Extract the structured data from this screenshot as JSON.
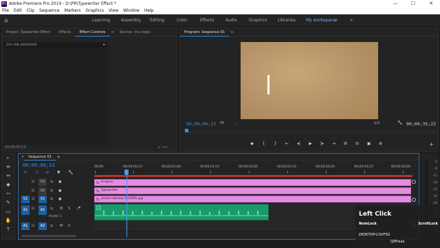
{
  "window": {
    "app_icon_text": "Pr",
    "title": "Adobe Premiere Pro 2019 - D:\\PR\\Typewriter Effect *",
    "controls": [
      "—",
      "☐",
      "✕"
    ]
  },
  "menu": [
    "File",
    "Edit",
    "Clip",
    "Sequence",
    "Markers",
    "Graphics",
    "View",
    "Window",
    "Help"
  ],
  "workspaces": {
    "items": [
      "Learning",
      "Assembly",
      "Editing",
      "Color",
      "Effects",
      "Audio",
      "Graphics",
      "Libraries"
    ],
    "active": "My workspace",
    "active_menu_icon": "≡",
    "more": "»"
  },
  "left_panel": {
    "tabs": [
      "Project: Typewriter Effect",
      "Effects",
      "Effect Controls",
      "Source: (no clips)"
    ],
    "active_tab_menu": "≡",
    "clip_select": "(no clip selected)",
    "clip_select_arrow": "▸",
    "timecode": "00;00;00;13",
    "footer_icons": "⊿ ⇥ ⇤"
  },
  "program_panel": {
    "title": "Program: Sequence 01",
    "title_menu": "≡",
    "timecode": "00;00;00;13",
    "fit": "Fit",
    "resolution": "1/2",
    "duration": "00;00;35;22",
    "controls": [
      "◆",
      "{",
      "}",
      "⇤",
      "◂|",
      "▶",
      "|▸",
      "⇥",
      "⊞",
      "⊟",
      "▣",
      "⊕"
    ]
  },
  "tools": [
    "▸",
    "⇹",
    "⇔",
    "◆",
    "⇿",
    "✎",
    "▭",
    "✋",
    "T"
  ],
  "timeline": {
    "tab_title": "Sequence 01",
    "tab_menu": "≡",
    "timecode": "00;00;00;13",
    "ruler_labels": [
      "00;00",
      "00;00;00;15",
      "00;00;01;00",
      "00;00;01;15",
      "00;00;02;00",
      "00;00;02;15",
      "00;00;03;00",
      "00;00;03;15",
      "00;00;04;00"
    ],
    "tracks": {
      "v3": "V3",
      "v2": "V2",
      "v1": "V1",
      "a1": "A1",
      "a2": "A2",
      "audio1_name": "Audio 1",
      "lock": "⊡",
      "eye": "●",
      "m": "M",
      "s": "S",
      "mic": "🎤"
    },
    "clips": {
      "v3": "Graphic",
      "v2": "Typewriter",
      "v1": "pexels-abaxey-233985.jpg"
    },
    "tool_icons": [
      "⊓",
      "⊃",
      "⊳",
      "▼",
      "🔧"
    ],
    "clip_fx_glyph": "fx"
  },
  "meters": [
    "0",
    "-6",
    "-12",
    "-18",
    "-24",
    "-30",
    "-36",
    "-42",
    "-48",
    "-54",
    "dB"
  ],
  "key_overlay": {
    "action": "Left Click",
    "numlock": "NumLock",
    "scrolllock": "ScrollLock",
    "machine": "DESKTOP-CUVF5G",
    "brand": "QIPress"
  },
  "colors": {
    "accent": "#3e8ee8",
    "clip_video": "#e48be3",
    "clip_audio": "#1a9a6a",
    "workarea": "#b83232",
    "video_bg": "#b8956a"
  }
}
